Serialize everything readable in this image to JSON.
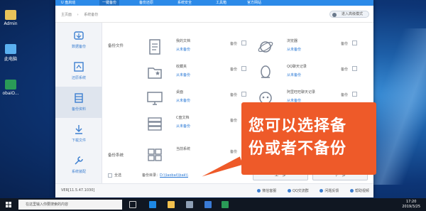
{
  "desktop": {
    "icons": [
      {
        "label": "Admin"
      },
      {
        "label": "此电脑"
      },
      {
        "label": "obaiO..."
      }
    ]
  },
  "app": {
    "tabs": [
      "U 盘启动",
      "一键备份",
      "备份还原",
      "系统安全",
      "工具箱",
      "官方网站"
    ],
    "breadcrumb": [
      "主页面",
      "系统备份"
    ],
    "mode_button": "进入高级模式",
    "sidebar": [
      "数据备份",
      "还原系统",
      "备份资料",
      "下载文件",
      "系统装配"
    ],
    "groups": {
      "files": "备份文件",
      "system": "备份系统"
    },
    "items": [
      {
        "name": "我的文档",
        "status": "从未备份",
        "backup_label": "备份"
      },
      {
        "name": "浏览器",
        "status": "从未备份",
        "backup_label": "备份"
      },
      {
        "name": "收藏夹",
        "status": "从未备份",
        "backup_label": "备份"
      },
      {
        "name": "QQ聊天记录",
        "status": "从未备份",
        "backup_label": "备份"
      },
      {
        "name": "桌面",
        "status": "从未备份",
        "backup_label": "备份"
      },
      {
        "name": "阿里旺旺聊天记录",
        "status": "从未备份",
        "backup_label": "备份"
      },
      {
        "name": "C盘文档",
        "status": "从未备份",
        "backup_label": "备份"
      },
      {
        "name": "当前系统",
        "status": "",
        "backup_label": "备份"
      }
    ],
    "select_all": "全选",
    "backup_dir_label": "备份目录：",
    "backup_dir_value": "D:\\\\laobai\\\\bak\\\\",
    "prev_button": "上一步",
    "next_button": "下一步",
    "version": "VER[11.5.47.1030]",
    "footer_links": [
      "微信客服",
      "QQ交流群",
      "问题反馈",
      "帮助视频"
    ]
  },
  "tooltip": {
    "line1": "您可以选择备",
    "line2": "份或者不备份"
  },
  "taskbar": {
    "search_placeholder": "在这里输入你要搜索的内容",
    "time": "17:20",
    "date": "2019/3/25"
  }
}
